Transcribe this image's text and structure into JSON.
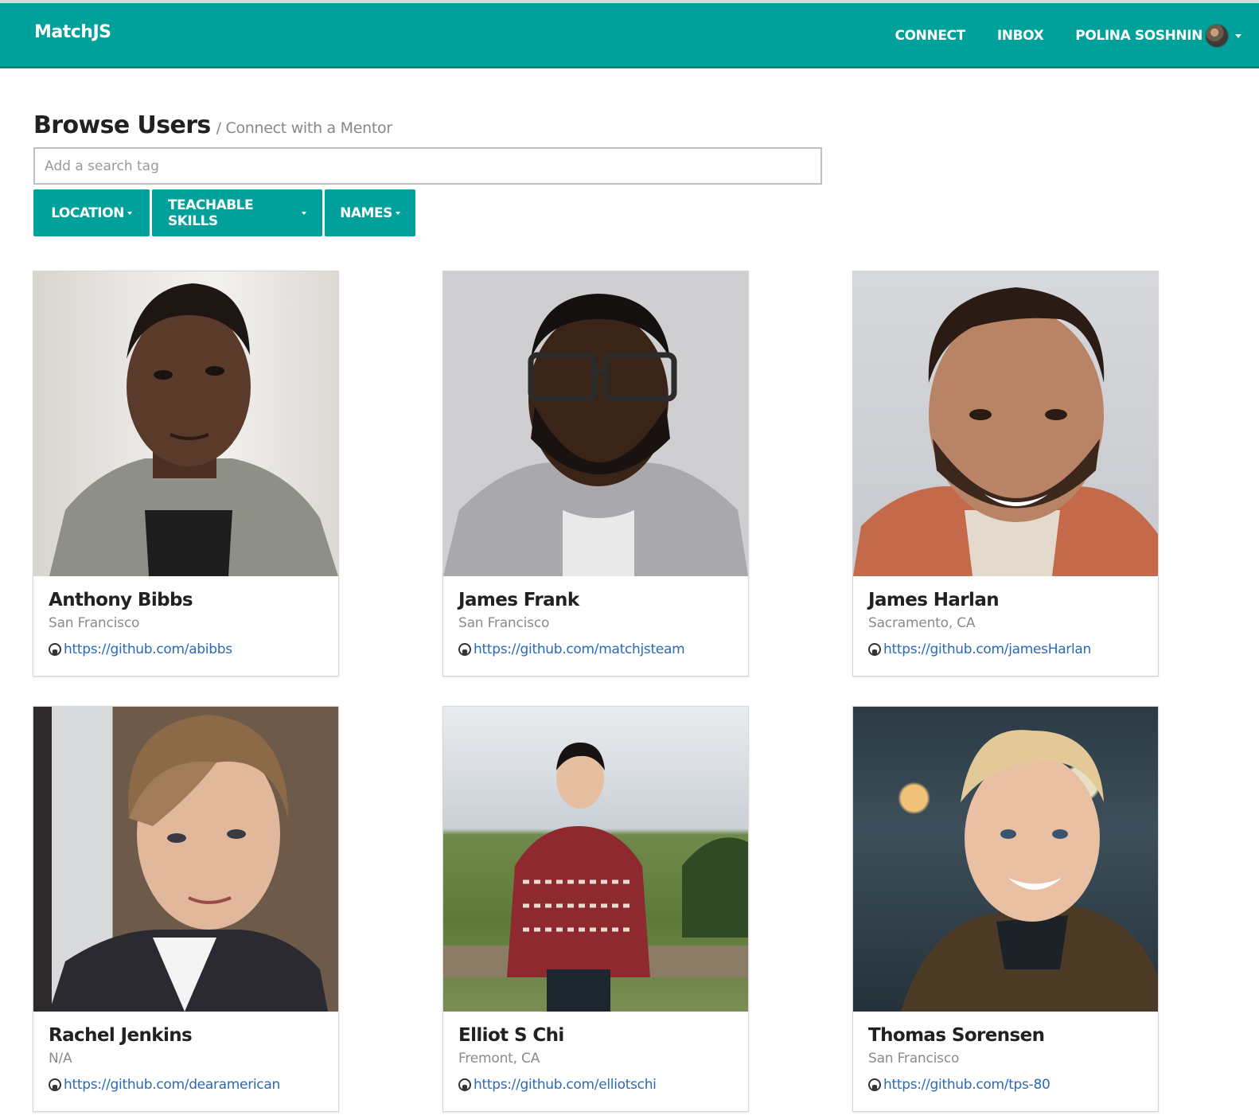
{
  "navbar": {
    "brand": "MatchJS",
    "links": {
      "connect": "CONNECT",
      "inbox": "INBOX",
      "user": "POLINA SOSHNIN"
    }
  },
  "page": {
    "title": "Browse Users",
    "subtitle": "/ Connect with a Mentor"
  },
  "search": {
    "placeholder": "Add a search tag",
    "value": ""
  },
  "filters": {
    "location": "LOCATION",
    "skills": "TEACHABLE SKILLS",
    "names": "NAMES"
  },
  "users": [
    {
      "name": "Anthony Bibbs",
      "location": "San Francisco",
      "github": "https://github.com/abibbs"
    },
    {
      "name": "James Frank",
      "location": "San Francisco",
      "github": "https://github.com/matchjsteam"
    },
    {
      "name": "James Harlan",
      "location": "Sacramento, CA",
      "github": "https://github.com/jamesHarlan"
    },
    {
      "name": "Rachel Jenkins",
      "location": "N/A",
      "github": "https://github.com/dearamerican"
    },
    {
      "name": "Elliot S Chi",
      "location": "Fremont, CA",
      "github": "https://github.com/elliotschi"
    },
    {
      "name": "Thomas Sorensen",
      "location": "San Francisco",
      "github": "https://github.com/tps-80"
    }
  ],
  "colors": {
    "primary": "#00a19a",
    "link": "#2a6ab8"
  },
  "icons": {
    "github": "github-icon",
    "caret": "caret-down-icon"
  }
}
